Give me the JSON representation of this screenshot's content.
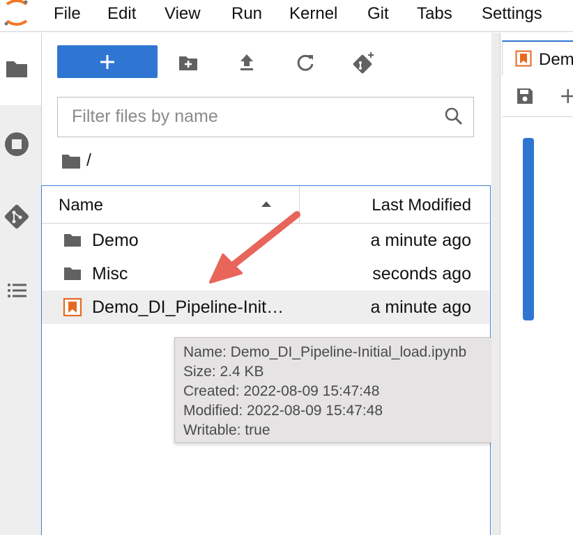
{
  "menubar": {
    "items": [
      "File",
      "Edit",
      "View",
      "Run",
      "Kernel",
      "Git",
      "Tabs",
      "Settings"
    ]
  },
  "activitybar": {
    "icons": [
      "folder-icon",
      "running-stop-icon",
      "git-icon",
      "toc-list-icon"
    ]
  },
  "filebrowser": {
    "new_launcher_label": "+",
    "filter_placeholder": "Filter files by name",
    "filter_value": "",
    "breadcrumb": "/",
    "columns": {
      "name": "Name",
      "last_modified": "Last Modified"
    },
    "sort": "ascending",
    "files": [
      {
        "name": "Demo",
        "modified": "a minute ago",
        "type": "folder"
      },
      {
        "name": "Misc",
        "modified": "seconds ago",
        "type": "folder"
      },
      {
        "name": "Demo_DI_Pipeline-Init…",
        "modified": "a minute ago",
        "type": "notebook",
        "selected": true
      }
    ]
  },
  "tooltip": {
    "lines": [
      "Name: Demo_DI_Pipeline-Initial_load.ipynb",
      "Size: 2.4 KB",
      "Created: 2022-08-09 15:47:48",
      "Modified: 2022-08-09 15:47:48",
      "Writable: true"
    ]
  },
  "main": {
    "tab_label": "Demo"
  },
  "colors": {
    "accent": "#2f76d2",
    "notebook_icon": "#e56a21",
    "annotation_arrow": "#e8655a"
  }
}
